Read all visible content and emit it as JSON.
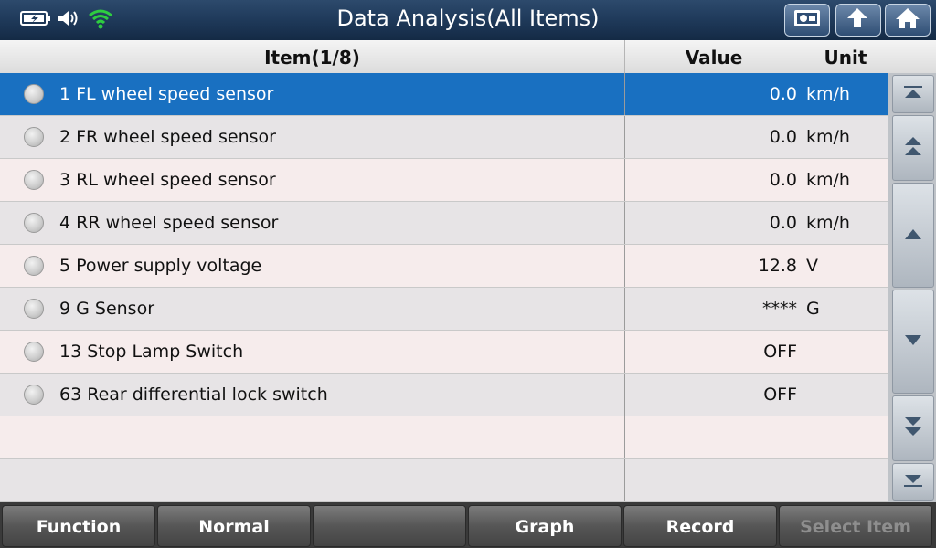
{
  "window": {
    "title": "Data Analysis(All Items)"
  },
  "status_icons": [
    "battery-charging-icon",
    "speaker-icon",
    "wifi-icon"
  ],
  "title_buttons": [
    "report-icon",
    "back-arrow-icon",
    "home-icon"
  ],
  "table": {
    "columns": {
      "item": "Item(1/8)",
      "value": "Value",
      "unit": "Unit"
    },
    "selected_index": 0,
    "rows": [
      {
        "item": "1 FL wheel speed sensor",
        "value": "0.0",
        "unit": "km/h"
      },
      {
        "item": "2 FR wheel speed sensor",
        "value": "0.0",
        "unit": "km/h"
      },
      {
        "item": "3 RL wheel speed sensor",
        "value": "0.0",
        "unit": "km/h"
      },
      {
        "item": "4 RR wheel speed sensor",
        "value": "0.0",
        "unit": "km/h"
      },
      {
        "item": "5 Power supply voltage",
        "value": "12.8",
        "unit": "V"
      },
      {
        "item": "9 G Sensor",
        "value": "****",
        "unit": "G"
      },
      {
        "item": "13 Stop Lamp Switch",
        "value": "OFF",
        "unit": ""
      },
      {
        "item": "63 Rear differential lock switch",
        "value": "OFF",
        "unit": ""
      }
    ]
  },
  "scroll_buttons": [
    "scroll-top-icon",
    "page-up-icon",
    "line-up-icon",
    "line-down-icon",
    "page-down-icon",
    "scroll-bottom-icon"
  ],
  "toolbar": {
    "function": "Function",
    "normal": "Normal",
    "blank": "",
    "graph": "Graph",
    "record": "Record",
    "select_item": "Select Item"
  },
  "colors": {
    "selected_row": "#1970c1",
    "titlebar": "#203b5c",
    "wifi": "#2ecc40"
  }
}
